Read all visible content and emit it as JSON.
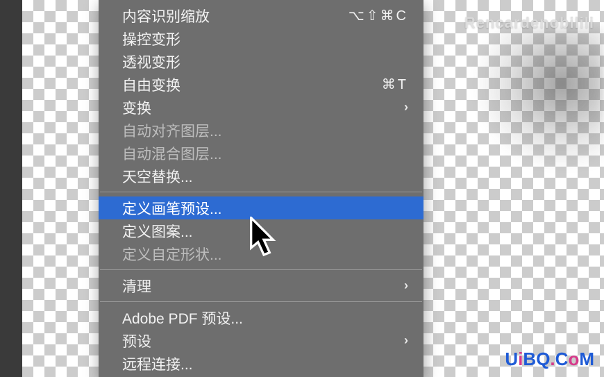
{
  "menu": {
    "items": [
      {
        "label": "内容识别缩放",
        "shortcut": "⌥⇧⌘C",
        "submenu": false,
        "disabled": false,
        "highlight": false
      },
      {
        "label": "操控变形",
        "shortcut": "",
        "submenu": false,
        "disabled": false,
        "highlight": false
      },
      {
        "label": "透视变形",
        "shortcut": "",
        "submenu": false,
        "disabled": false,
        "highlight": false
      },
      {
        "label": "自由变换",
        "shortcut": "⌘T",
        "submenu": false,
        "disabled": false,
        "highlight": false
      },
      {
        "label": "变换",
        "shortcut": "",
        "submenu": true,
        "disabled": false,
        "highlight": false
      },
      {
        "label": "自动对齐图层...",
        "shortcut": "",
        "submenu": false,
        "disabled": true,
        "highlight": false
      },
      {
        "label": "自动混合图层...",
        "shortcut": "",
        "submenu": false,
        "disabled": true,
        "highlight": false
      },
      {
        "label": "天空替换...",
        "shortcut": "",
        "submenu": false,
        "disabled": false,
        "highlight": false
      }
    ],
    "group2": [
      {
        "label": "定义画笔预设...",
        "shortcut": "",
        "submenu": false,
        "disabled": false,
        "highlight": true
      },
      {
        "label": "定义图案...",
        "shortcut": "",
        "submenu": false,
        "disabled": false,
        "highlight": false
      },
      {
        "label": "定义自定形状...",
        "shortcut": "",
        "submenu": false,
        "disabled": true,
        "highlight": false
      }
    ],
    "group3": [
      {
        "label": "清理",
        "shortcut": "",
        "submenu": true,
        "disabled": false,
        "highlight": false
      }
    ],
    "group4": [
      {
        "label": "Adobe PDF 预设...",
        "shortcut": "",
        "submenu": false,
        "disabled": false,
        "highlight": false
      },
      {
        "label": "预设",
        "shortcut": "",
        "submenu": true,
        "disabled": false,
        "highlight": false
      },
      {
        "label": "远程连接...",
        "shortcut": "",
        "submenu": false,
        "disabled": false,
        "highlight": false
      }
    ]
  },
  "watermarks": {
    "top": "Rencardenobilili",
    "bottom": {
      "u": "U",
      "i": "i",
      "bq": "BQ",
      "dot": ".",
      "c": "C",
      "o": "o",
      "m": "M"
    }
  }
}
